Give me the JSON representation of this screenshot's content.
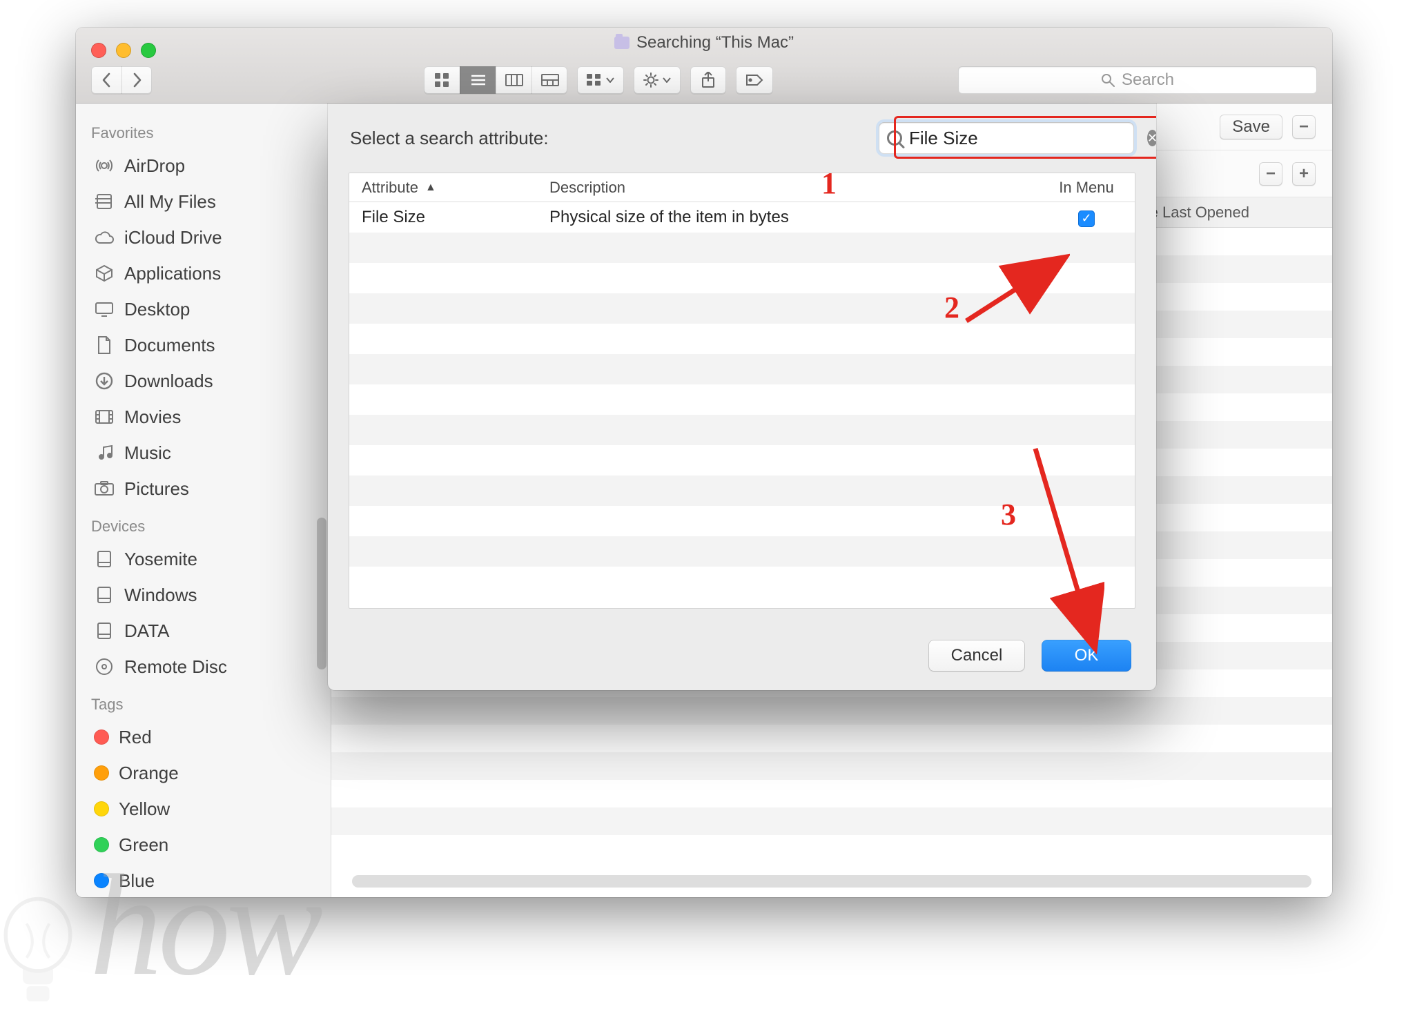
{
  "window": {
    "title": "Searching “This Mac”",
    "toolbar_search_placeholder": "Search",
    "save_label": "Save"
  },
  "sidebar": {
    "sections": {
      "favorites_label": "Favorites",
      "devices_label": "Devices",
      "tags_label": "Tags"
    },
    "favorites": [
      {
        "label": "AirDrop"
      },
      {
        "label": "All My Files"
      },
      {
        "label": "iCloud Drive"
      },
      {
        "label": "Applications"
      },
      {
        "label": "Desktop"
      },
      {
        "label": "Documents"
      },
      {
        "label": "Downloads"
      },
      {
        "label": "Movies"
      },
      {
        "label": "Music"
      },
      {
        "label": "Pictures"
      }
    ],
    "devices": [
      {
        "label": "Yosemite"
      },
      {
        "label": "Windows"
      },
      {
        "label": "DATA"
      },
      {
        "label": "Remote Disc"
      }
    ],
    "tag_items": [
      {
        "label": "Red",
        "cls": "tag-red"
      },
      {
        "label": "Orange",
        "cls": "tag-orange"
      },
      {
        "label": "Yellow",
        "cls": "tag-yellow"
      },
      {
        "label": "Green",
        "cls": "tag-green"
      },
      {
        "label": "Blue",
        "cls": "tag-blue"
      }
    ]
  },
  "list_header": {
    "date_last_opened": "e Last Opened"
  },
  "sheet": {
    "title": "Select a search attribute:",
    "search_value": "File Size",
    "columns": {
      "attribute": "Attribute",
      "description": "Description",
      "in_menu": "In Menu"
    },
    "rows": [
      {
        "attribute": "File Size",
        "description": "Physical size of the item in bytes",
        "in_menu": true
      }
    ],
    "cancel_label": "Cancel",
    "ok_label": "OK"
  },
  "annotations": {
    "n1": "1",
    "n2": "2",
    "n3": "3"
  },
  "watermark": "how"
}
